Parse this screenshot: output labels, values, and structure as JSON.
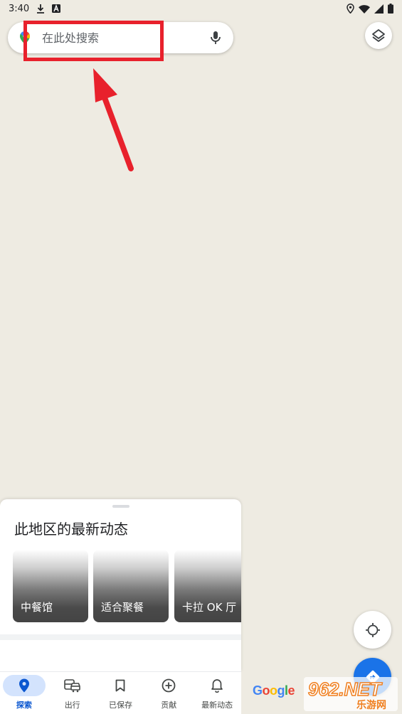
{
  "status_bar": {
    "time": "3:40",
    "icons": [
      "download-icon",
      "app-badge-icon",
      "location-pin-icon",
      "wifi-icon",
      "signal-icon",
      "battery-icon"
    ]
  },
  "search": {
    "placeholder": "在此处搜索",
    "icons": [
      "google-maps-icon",
      "mic-icon"
    ]
  },
  "layers": {
    "icon": "layers-icon"
  },
  "sheet": {
    "title": "此地区的最新动态",
    "cards": [
      {
        "label": "中餐馆"
      },
      {
        "label": "适合聚餐"
      },
      {
        "label": "卡拉 OK 厅"
      }
    ]
  },
  "map_controls": {
    "location_icon": "my-location-icon",
    "directions_icon": "directions-icon",
    "logo": "Google"
  },
  "watermark": {
    "main": "962.NET",
    "sub": "乐游网"
  },
  "nav": {
    "items": [
      {
        "label": "探索",
        "icon": "explore-pin-icon",
        "active": true
      },
      {
        "label": "出行",
        "icon": "commute-icon",
        "active": false
      },
      {
        "label": "已保存",
        "icon": "bookmark-icon",
        "active": false
      },
      {
        "label": "贡献",
        "icon": "add-circle-icon",
        "active": false
      },
      {
        "label": "最新动态",
        "icon": "bell-icon",
        "active": false
      }
    ]
  },
  "colors": {
    "map_background": "#eeebe2",
    "annotation_red": "#e8212c",
    "accent_blue": "#1a73e8",
    "nav_active_bg": "#d3e3fd"
  }
}
